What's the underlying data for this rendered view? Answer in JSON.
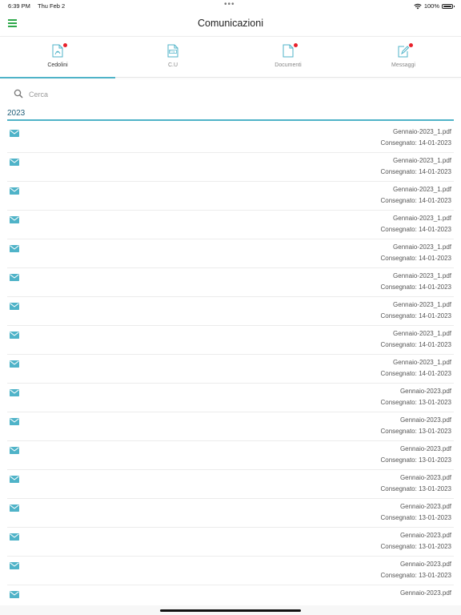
{
  "status_bar": {
    "time": "6:39 PM",
    "date": "Thu Feb 2",
    "dots": "•••",
    "battery": "100%"
  },
  "header": {
    "title": "Comunicazioni"
  },
  "tabs": [
    {
      "label": "Cedolini",
      "icon": "pdf-document-icon",
      "badge": true,
      "active": true
    },
    {
      "label": "C.U",
      "icon": "pdf-file-icon",
      "badge": false,
      "active": false
    },
    {
      "label": "Documenti",
      "icon": "document-icon",
      "badge": true,
      "active": false
    },
    {
      "label": "Messaggi",
      "icon": "compose-icon",
      "badge": true,
      "active": false
    }
  ],
  "search": {
    "placeholder": "Cerca"
  },
  "section": {
    "year": "2023"
  },
  "rows": [
    {
      "file": "Gennaio-2023_1.pdf",
      "delivered": "Consegnato: 14-01-2023"
    },
    {
      "file": "Gennaio-2023_1.pdf",
      "delivered": "Consegnato: 14-01-2023"
    },
    {
      "file": "Gennaio-2023_1.pdf",
      "delivered": "Consegnato: 14-01-2023"
    },
    {
      "file": "Gennaio-2023_1.pdf",
      "delivered": "Consegnato: 14-01-2023"
    },
    {
      "file": "Gennaio-2023_1.pdf",
      "delivered": "Consegnato: 14-01-2023"
    },
    {
      "file": "Gennaio-2023_1.pdf",
      "delivered": "Consegnato: 14-01-2023"
    },
    {
      "file": "Gennaio-2023_1.pdf",
      "delivered": "Consegnato: 14-01-2023"
    },
    {
      "file": "Gennaio-2023_1.pdf",
      "delivered": "Consegnato: 14-01-2023"
    },
    {
      "file": "Gennaio-2023_1.pdf",
      "delivered": "Consegnato: 14-01-2023"
    },
    {
      "file": "Gennaio-2023.pdf",
      "delivered": "Consegnato: 13-01-2023"
    },
    {
      "file": "Gennaio-2023.pdf",
      "delivered": "Consegnato: 13-01-2023"
    },
    {
      "file": "Gennaio-2023.pdf",
      "delivered": "Consegnato: 13-01-2023"
    },
    {
      "file": "Gennaio-2023.pdf",
      "delivered": "Consegnato: 13-01-2023"
    },
    {
      "file": "Gennaio-2023.pdf",
      "delivered": "Consegnato: 13-01-2023"
    },
    {
      "file": "Gennaio-2023.pdf",
      "delivered": "Consegnato: 13-01-2023"
    },
    {
      "file": "Gennaio-2023.pdf",
      "delivered": "Consegnato: 13-01-2023"
    },
    {
      "file": "Gennaio-2023.pdf",
      "delivered": ""
    }
  ],
  "colors": {
    "accent": "#4fb3c8",
    "menu": "#2ea84a",
    "badge": "#e8202a",
    "year_text": "#1f5d78"
  }
}
